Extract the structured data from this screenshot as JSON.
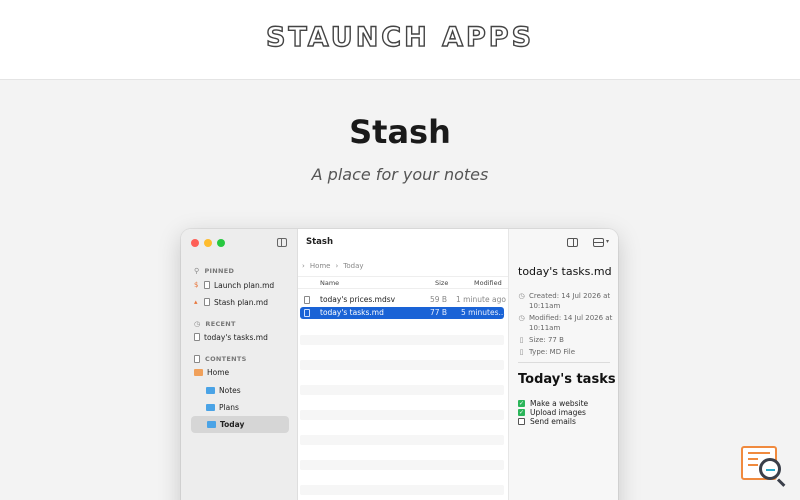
{
  "brand": "STAUNCH APPS",
  "hero": {
    "title": "Stash",
    "subtitle": "A place for your notes"
  },
  "window": {
    "sidebar": {
      "pinned_label": "PINNED",
      "pinned": [
        "Launch plan.md",
        "Stash plan.md"
      ],
      "recent_label": "RECENT",
      "recent": [
        "today's tasks.md"
      ],
      "contents_label": "CONTENTS",
      "folders": [
        "Home",
        "Notes",
        "Plans",
        "Today"
      ],
      "selected_folder": "Today"
    },
    "middle": {
      "title": "Stash",
      "breadcrumb": [
        "Home",
        "Today"
      ],
      "columns": [
        "Name",
        "Size",
        "Modified"
      ],
      "files": [
        {
          "name": "today's prices.mdsv",
          "size": "59 B",
          "modified": "1 minute ago"
        },
        {
          "name": "today's tasks.md",
          "size": "77 B",
          "modified": "5 minutes..."
        }
      ]
    },
    "inspector": {
      "file_name": "today's tasks.md",
      "created": "Created: 14 Jul 2026 at 10:11am",
      "modified": "Modified: 14 Jul 2026 at 10:11am",
      "size": "Size: 77 B",
      "type": "Type: MD File",
      "heading": "Today's tasks",
      "tasks": [
        {
          "label": "Make a website",
          "done": true
        },
        {
          "label": "Upload images",
          "done": true
        },
        {
          "label": "Send emails",
          "done": false
        }
      ]
    }
  },
  "colors": {
    "selection": "#1a63d6",
    "accent": "#f08a3e",
    "check": "#2bb55a"
  }
}
